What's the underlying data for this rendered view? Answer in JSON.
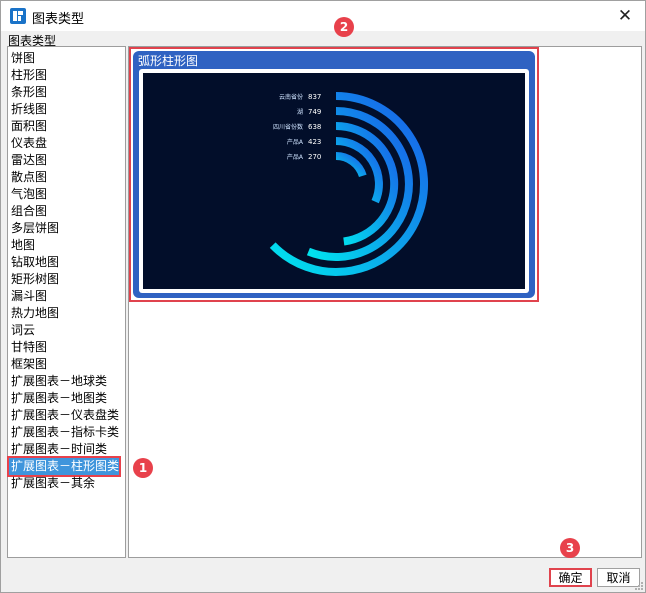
{
  "window": {
    "title": "图表类型",
    "close_label": "✕"
  },
  "group_label": "图表类型",
  "chart_types": [
    "饼图",
    "柱形图",
    "条形图",
    "折线图",
    "面积图",
    "仪表盘",
    "雷达图",
    "散点图",
    "气泡图",
    "组合图",
    "多层饼图",
    "地图",
    "钻取地图",
    "矩形树图",
    "漏斗图",
    "热力地图",
    "词云",
    "甘特图",
    "框架图",
    "扩展图表－地球类",
    "扩展图表－地图类",
    "扩展图表－仪表盘类",
    "扩展图表－指标卡类",
    "扩展图表－时间类",
    "扩展图表－柱形图类",
    "扩展图表－其余"
  ],
  "selected_index": 24,
  "preview": {
    "title": "弧形柱形图",
    "chart_data": {
      "type": "bar",
      "subtype": "radial-arc",
      "categories": [
        "云南省份",
        "湖",
        "四川省份数",
        "产品A",
        "产品A"
      ],
      "values": [
        837,
        749,
        638,
        423,
        270
      ],
      "background_color": "#020e2a",
      "gradient": [
        "#00e5ee",
        "#1a5be8"
      ]
    }
  },
  "badges": [
    "1",
    "2",
    "3"
  ],
  "buttons": {
    "ok": "确定",
    "cancel": "取消"
  }
}
